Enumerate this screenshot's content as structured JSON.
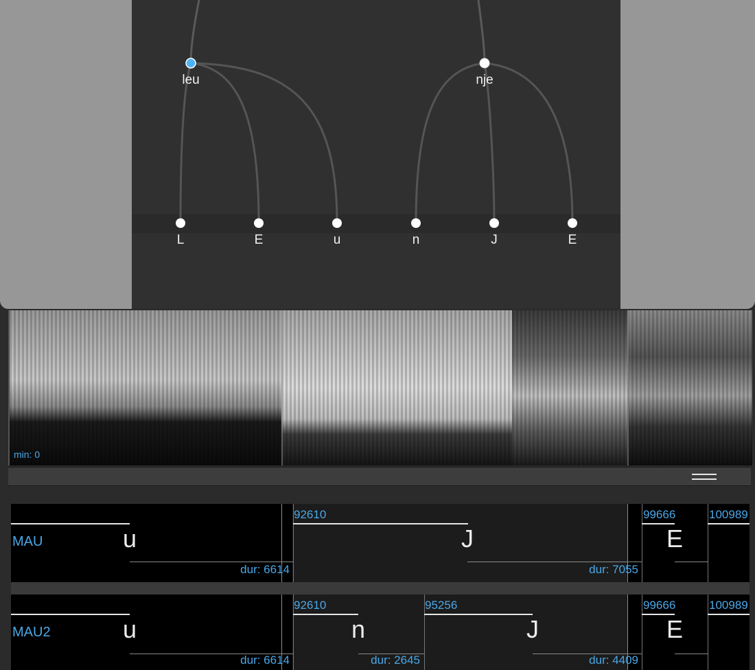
{
  "hierarchy": {
    "parents": [
      {
        "label": "leu",
        "selected": true
      },
      {
        "label": "nje",
        "selected": false
      }
    ],
    "children": [
      "L",
      "E",
      "u",
      "n",
      "J",
      "E"
    ],
    "colors": {
      "selected_node": "#4db3f5",
      "node": "#ffffff",
      "edge": "#5a5a5a"
    }
  },
  "spectrogram": {
    "min_label": "min: 0"
  },
  "tiers": [
    {
      "name": "MAU",
      "segments": [
        {
          "start": "",
          "label": "u",
          "dur": "dur: 6614"
        },
        {
          "start": "92610",
          "label": "J",
          "dur": "dur: 7055"
        },
        {
          "start": "99666",
          "label": "E",
          "dur": ""
        },
        {
          "start": "100989",
          "label": "",
          "dur": ""
        }
      ]
    },
    {
      "name": "MAU2",
      "segments": [
        {
          "start": "",
          "label": "u",
          "dur": "dur: 6614"
        },
        {
          "start": "92610",
          "label": "n",
          "dur": "dur: 2645"
        },
        {
          "start": "95256",
          "label": "J",
          "dur": "dur: 4409"
        },
        {
          "start": "99666",
          "label": "E",
          "dur": ""
        },
        {
          "start": "100989",
          "label": "",
          "dur": ""
        }
      ]
    }
  ],
  "accent_color": "#4aa8e8"
}
